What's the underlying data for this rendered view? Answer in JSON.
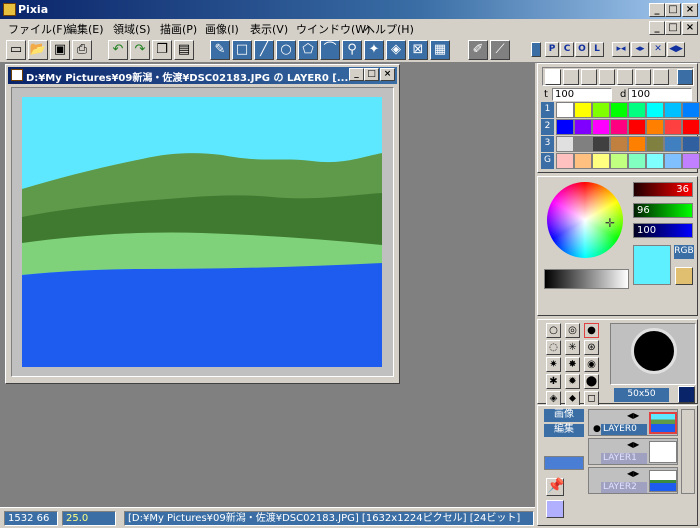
{
  "app": {
    "title": "Pixia"
  },
  "menu": [
    "ファイル(F)",
    "編集(E)",
    "領域(S)",
    "描画(P)",
    "画像(I)",
    "表示(V)",
    "ウインドウ(W)",
    "ヘルプ(H)"
  ],
  "toolbar": {
    "small_buttons": [
      "P",
      "C",
      "O",
      "L",
      "▸◂",
      "◂▸",
      "✕",
      "◀▶"
    ]
  },
  "document": {
    "title": "D:¥My Pictures¥09新潟・佐渡¥DSC02183.JPG の LAYER0 [..."
  },
  "palette": {
    "opacity_label": "t",
    "opacity_value": "100",
    "density_label": "d",
    "density_value": "100",
    "row_labels": [
      "1",
      "2",
      "3",
      "G"
    ],
    "rows": [
      [
        "#ffffff",
        "#ffff00",
        "#80ff00",
        "#00ff00",
        "#00ff80",
        "#00ffff",
        "#00c0ff",
        "#0080ff"
      ],
      [
        "#0000ff",
        "#8000ff",
        "#ff00ff",
        "#ff0080",
        "#ff0000",
        "#ff8000",
        "#ff4040",
        "#ff0000"
      ],
      [
        "#e0e0e0",
        "#808080",
        "#404040",
        "#c08040",
        "#ff8000",
        "#808040",
        "#4080c0",
        "#3060a0"
      ],
      [
        "#ffc0c0",
        "#ffc080",
        "#ffff80",
        "#c0ff80",
        "#80ffc0",
        "#80ffff",
        "#80c0ff",
        "#c080ff"
      ]
    ]
  },
  "color": {
    "r": "36",
    "g": "96",
    "b": "100",
    "mode_label": "RGB",
    "current": "#5ff0ff"
  },
  "brush": {
    "size_label": "50x50"
  },
  "layers": {
    "image_tab": "画像",
    "edit_tab": "編集",
    "items": [
      {
        "name": "LAYER0",
        "active": true
      },
      {
        "name": "LAYER1",
        "active": false
      },
      {
        "name": "LAYER2",
        "active": false
      }
    ]
  },
  "status": {
    "coords": "1532 66",
    "zoom": "25.0",
    "info": "[D:¥My Pictures¥09新潟・佐渡¥DSC02183.JPG] [1632x1224ピクセル] [24ビット]"
  },
  "colors": {
    "sky": "#5ee8ff",
    "far_hill": "#5e9a4a",
    "near_hill": "#3f7a30",
    "beach": "#7fd27a",
    "sea": "#1e5cf0",
    "title_blue": "#0a246a"
  }
}
